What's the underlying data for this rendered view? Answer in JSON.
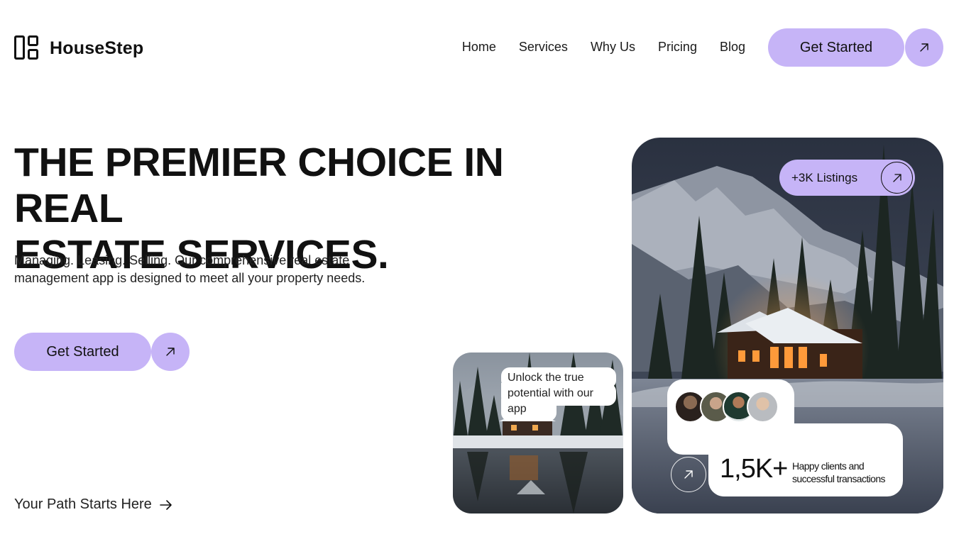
{
  "brand": {
    "name": "HouseStep",
    "logo_icon": "grid-logo-icon"
  },
  "nav": {
    "items": [
      {
        "label": "Home"
      },
      {
        "label": "Services"
      },
      {
        "label": "Why Us"
      },
      {
        "label": "Pricing"
      },
      {
        "label": "Blog"
      }
    ],
    "cta_label": "Get Started",
    "cta_icon": "arrow-up-right-icon"
  },
  "hero": {
    "title_line1": "THE PREMIER CHOICE IN REAL",
    "title_line2": "ESTATE SERVICES.",
    "subtitle": "Managing. Leasing. Selling. Our comprehensive real estate management app is designed to meet all your property needs.",
    "cta_label": "Get Started",
    "cta_icon": "arrow-up-right-icon",
    "path_link": "Your Path Starts Here",
    "path_icon": "arrow-right-icon"
  },
  "card_small": {
    "bubble_line1": "Unlock the true",
    "bubble_line2": "potential with our",
    "bubble_line3": "app"
  },
  "card_big": {
    "listings_label": "+3K Listings",
    "stat_value": "1,5K+",
    "stat_label_line1": "Happy clients and",
    "stat_label_line2": "successful transactions"
  },
  "colors": {
    "accent": "#c6b4f7",
    "text": "#111111",
    "background": "#ffffff"
  }
}
